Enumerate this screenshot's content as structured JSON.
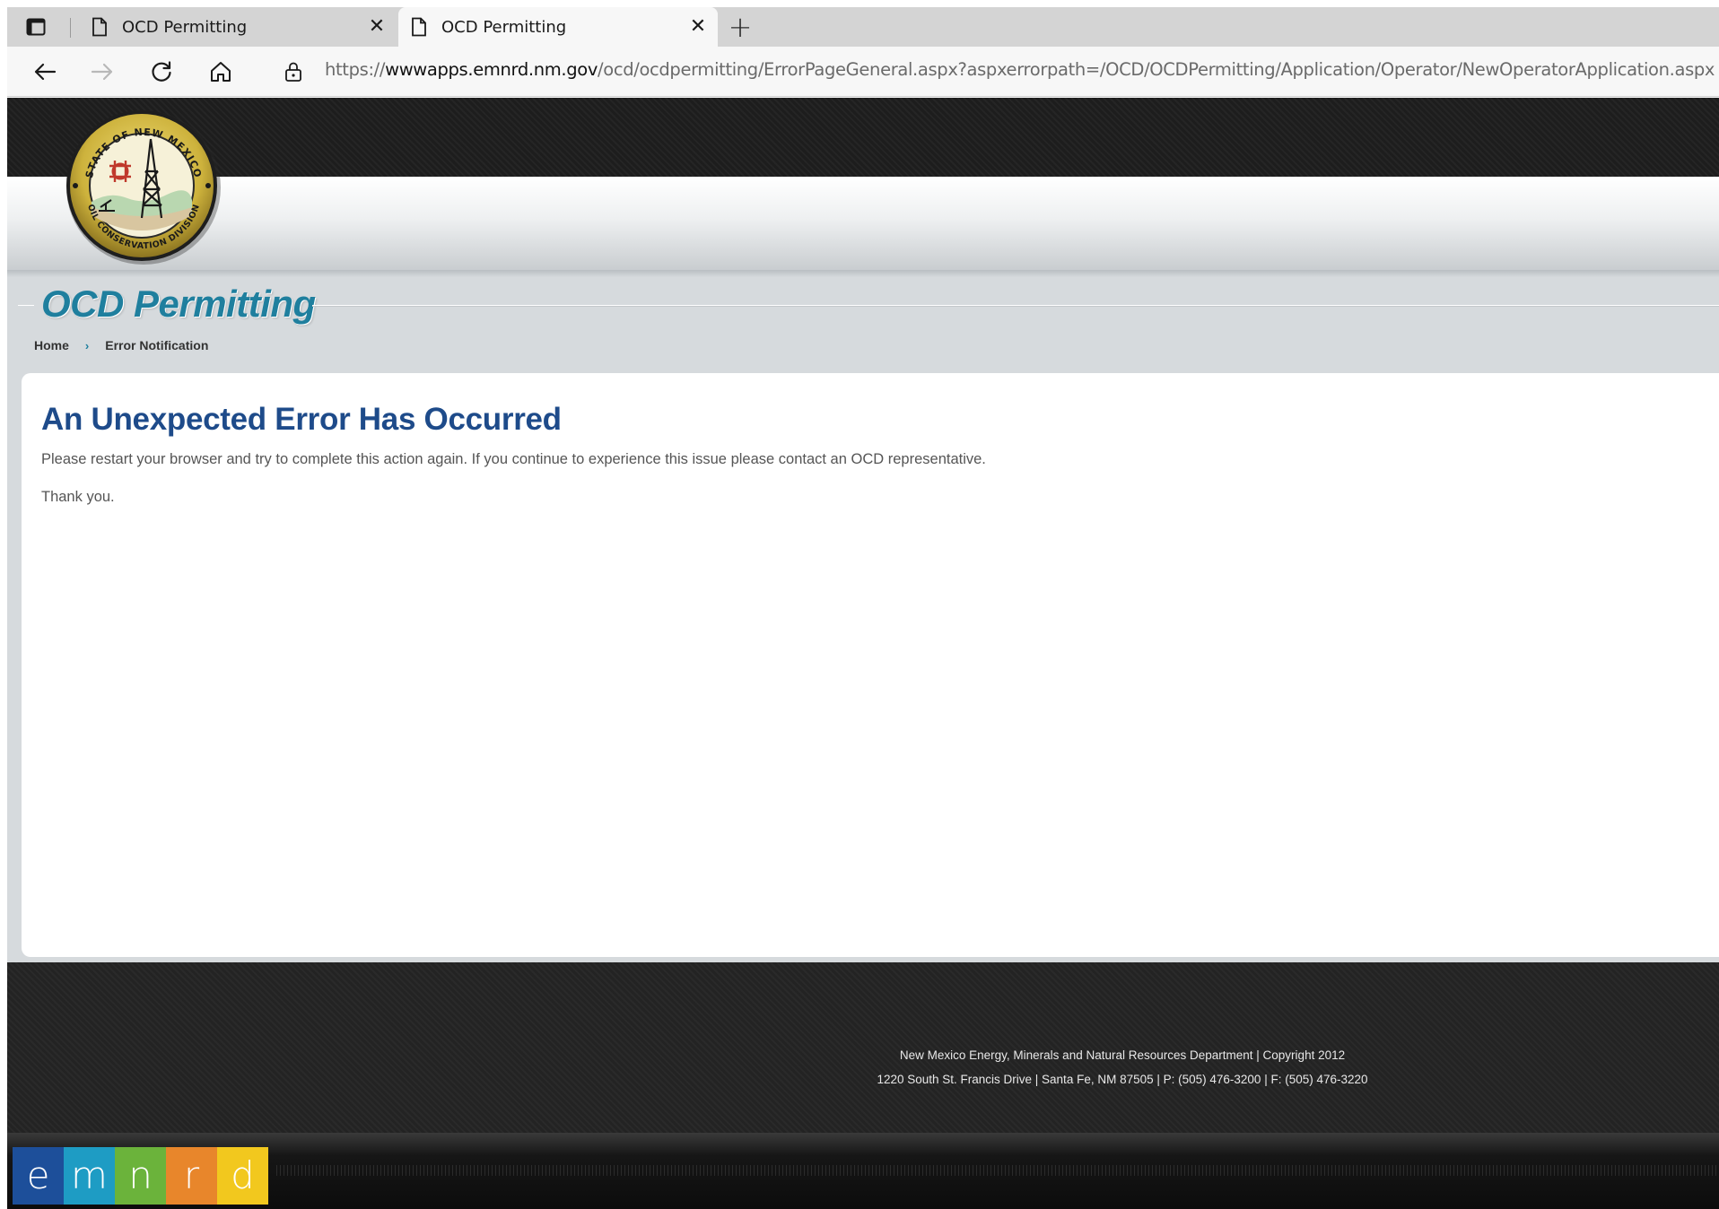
{
  "browser": {
    "tabs": [
      {
        "title": "OCD Permitting",
        "close": "✕"
      },
      {
        "title": "OCD Permitting",
        "close": "✕"
      }
    ],
    "new_tab": "+",
    "url": {
      "scheme": "https://",
      "host": "wwwapps.emnrd.nm.gov",
      "path": "/ocd/ocdpermitting/ErrorPageGeneral.aspx?aspxerrorpath=/OCD/OCDPermitting/Application/Operator/NewOperatorApplication.aspx"
    }
  },
  "header": {
    "seal_top_text": "STATE OF NEW MEXICO",
    "seal_bottom_text": "OIL CONSERVATION DIVISION",
    "app_title": "OCD Permitting"
  },
  "breadcrumb": {
    "home": "Home",
    "separator": "›",
    "current": "Error Notification"
  },
  "content": {
    "heading": "An Unexpected Error Has Occurred",
    "message": "Please restart your browser and try to complete this action again. If you continue to experience this issue please contact an OCD representative.",
    "thanks": "Thank you."
  },
  "footer": {
    "line1": "New Mexico Energy, Minerals and Natural Resources Department | Copyright 2012",
    "line2": "1220 South St. Francis Drive | Santa Fe, NM 87505 | P: (505) 476-3200 | F: (505) 476-3220"
  },
  "logo": {
    "letters": [
      {
        "char": "e",
        "color": "#1d4f9a"
      },
      {
        "char": "m",
        "color": "#1e9cc4"
      },
      {
        "char": "n",
        "color": "#6bb33b"
      },
      {
        "char": "r",
        "color": "#e8862b"
      },
      {
        "char": "d",
        "color": "#f2c81e"
      }
    ]
  },
  "colors": {
    "title": "#1f7f9e",
    "heading": "#1e4b8a",
    "header_dark": "#1d1d1d",
    "page_bg": "#d6dadd"
  }
}
